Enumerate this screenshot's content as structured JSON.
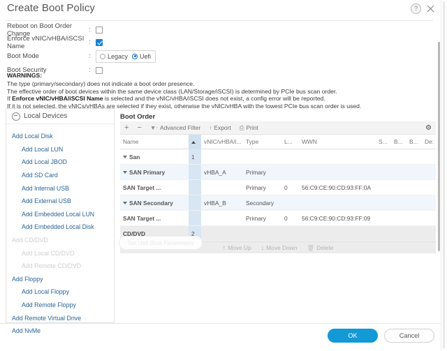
{
  "window": {
    "title": "Create Boot Policy",
    "help_icon": "help-circle-icon",
    "close_icon": "close-icon"
  },
  "form": {
    "rows": [
      {
        "label": "Reboot on Boot Order Change",
        "colon": ":",
        "control": "checkbox",
        "checked": false
      },
      {
        "label": "Enforce vNIC/vHBA/iSCSI Name",
        "colon": ":",
        "control": "checkbox",
        "checked": true
      },
      {
        "label": "Boot Mode",
        "colon": ":",
        "control": "radio"
      },
      {
        "label": "Boot Security",
        "colon": ":",
        "control": "checkbox",
        "checked": false
      }
    ],
    "boot_mode": {
      "options": [
        "Legacy",
        "Uefi"
      ],
      "selected": "Uefi"
    }
  },
  "warnings": {
    "heading": "WARNINGS:",
    "lines": [
      "The type (primary/secondary) does not indicate a boot order presence.",
      "The effective order of boot devices within the same device class (LAN/Storage/iSCSI) is determined by PCIe bus scan order.",
      "If it is not selected, the vNICs/vHBAs are selected if they exist, otherwise the vNIC/vHBA with the lowest PCIe bus scan order is used."
    ],
    "bold_line": {
      "pre": "If ",
      "bold": "Enforce vNIC/vHBA/iSCSI Name",
      "post": " is selected and the vNIC/vHBA/iSCSI does not exist, a config error will be reported."
    }
  },
  "local_devices": {
    "header": "Local Devices",
    "collapse_icon": "minus-circle-icon",
    "items": [
      {
        "label": "Add Local Disk",
        "indent": 0,
        "disabled": false
      },
      {
        "label": "Add Local LUN",
        "indent": 1,
        "disabled": false
      },
      {
        "label": "Add Local JBOD",
        "indent": 1,
        "disabled": false
      },
      {
        "label": "Add SD Card",
        "indent": 1,
        "disabled": false
      },
      {
        "label": "Add Internal USB",
        "indent": 1,
        "disabled": false
      },
      {
        "label": "Add External USB",
        "indent": 1,
        "disabled": false
      },
      {
        "label": "Add Embedded Local LUN",
        "indent": 1,
        "disabled": false
      },
      {
        "label": "Add Embedded Local Disk",
        "indent": 1,
        "disabled": false
      },
      {
        "label": "Add CD/DVD",
        "indent": 0,
        "disabled": true
      },
      {
        "label": "Add Local CD/DVD",
        "indent": 1,
        "disabled": true
      },
      {
        "label": "Add Remote CD/DVD",
        "indent": 1,
        "disabled": true
      },
      {
        "label": "Add Floppy",
        "indent": 0,
        "disabled": false
      },
      {
        "label": "Add Local Floppy",
        "indent": 1,
        "disabled": false
      },
      {
        "label": "Add Remote Floppy",
        "indent": 1,
        "disabled": false
      },
      {
        "label": "Add Remote Virtual Drive",
        "indent": 0,
        "disabled": false
      },
      {
        "label": "Add NvMe",
        "indent": 0,
        "disabled": false
      }
    ]
  },
  "boot_order": {
    "title": "Boot Order",
    "toolbar": {
      "add": "+",
      "remove": "−",
      "advanced_filter": "Advanced Filter",
      "export": "Export",
      "print": "Print",
      "settings_icon": "gear-icon"
    },
    "columns": [
      "Name",
      "",
      "vNIC/vHBA/i...",
      "Type",
      "L...",
      "WWN",
      "S...",
      "B...",
      "B...",
      "De:"
    ],
    "rows": [
      {
        "name": "San",
        "indent": 0,
        "order": "1",
        "vnic": "",
        "type": "",
        "lun": "",
        "wwn": "",
        "expander": true,
        "style": "plain"
      },
      {
        "name": "SAN Primary",
        "indent": 1,
        "order": "",
        "vnic": "vHBA_A",
        "type": "Primary",
        "lun": "",
        "wwn": "",
        "expander": true,
        "style": "alt"
      },
      {
        "name": "SAN Target ...",
        "indent": 2,
        "order": "",
        "vnic": "",
        "type": "Primary",
        "lun": "0",
        "wwn": "56:C9:CE:90:CD:93:FF:0A",
        "expander": false,
        "style": "plain"
      },
      {
        "name": "SAN Secondary",
        "indent": 1,
        "order": "",
        "vnic": "vHBA_B",
        "type": "Secondary",
        "lun": "",
        "wwn": "",
        "expander": true,
        "style": "alt"
      },
      {
        "name": "SAN Target ...",
        "indent": 2,
        "order": "",
        "vnic": "",
        "type": "Primary",
        "lun": "0",
        "wwn": "56:C9:CE:90:CD:93:FF:09",
        "expander": false,
        "style": "plain"
      },
      {
        "name": "CD/DVD",
        "indent": 0,
        "order": "2",
        "vnic": "",
        "type": "",
        "lun": "",
        "wwn": "",
        "expander": false,
        "style": "grey"
      }
    ],
    "actions": {
      "move_up": "Move Up",
      "move_down": "Move Down",
      "delete": "Delete"
    },
    "uefi_button": "Set Uefi Boot Parameters"
  },
  "footer": {
    "ok": "OK",
    "cancel": "Cancel"
  },
  "colors": {
    "accent": "#1399d5",
    "link": "#2a6496",
    "row_alt": "#f0f6fb",
    "order_col": "#d7e6f2",
    "checkbox_checked": "#1b7fd4"
  }
}
